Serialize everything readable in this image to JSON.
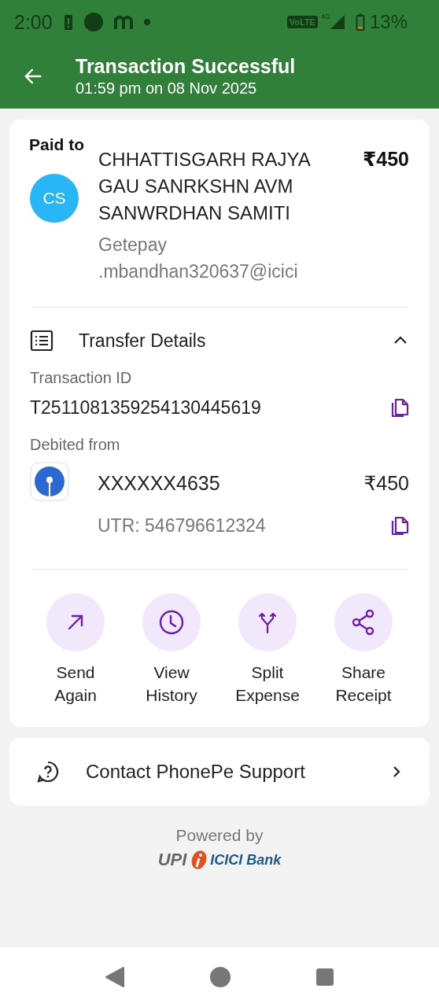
{
  "status_bar": {
    "time": "2:00",
    "network_label": "VoLTE",
    "network_type": "4G",
    "battery": "13%"
  },
  "header": {
    "title": "Transaction Successful",
    "subtitle": "01:59 pm on 08 Nov 2025"
  },
  "payee": {
    "label": "Paid to",
    "initials": "CS",
    "name": "CHHATTISGARH RAJYA GAU SANRKSHN AVM SANWRDHAN SAMITI",
    "upi_id": "Getepay .mbandhan320637@icici",
    "amount": "₹450"
  },
  "transfer_details": {
    "title": "Transfer Details",
    "expanded": true,
    "transaction_id_label": "Transaction ID",
    "transaction_id": "T2511081359254130445619",
    "debited_label": "Debited from",
    "account": "XXXXXX4635",
    "amount": "₹450",
    "utr": "UTR: 546796612324"
  },
  "actions": [
    {
      "kind": "send",
      "label": "Send Again"
    },
    {
      "kind": "history",
      "label": "View History"
    },
    {
      "kind": "split",
      "label": "Split Expense"
    },
    {
      "kind": "share",
      "label": "Share Receipt"
    }
  ],
  "support": {
    "label": "Contact PhonePe Support"
  },
  "footer": {
    "powered_by": "Powered by",
    "upi": "UPI",
    "bank": "ICICI Bank"
  }
}
